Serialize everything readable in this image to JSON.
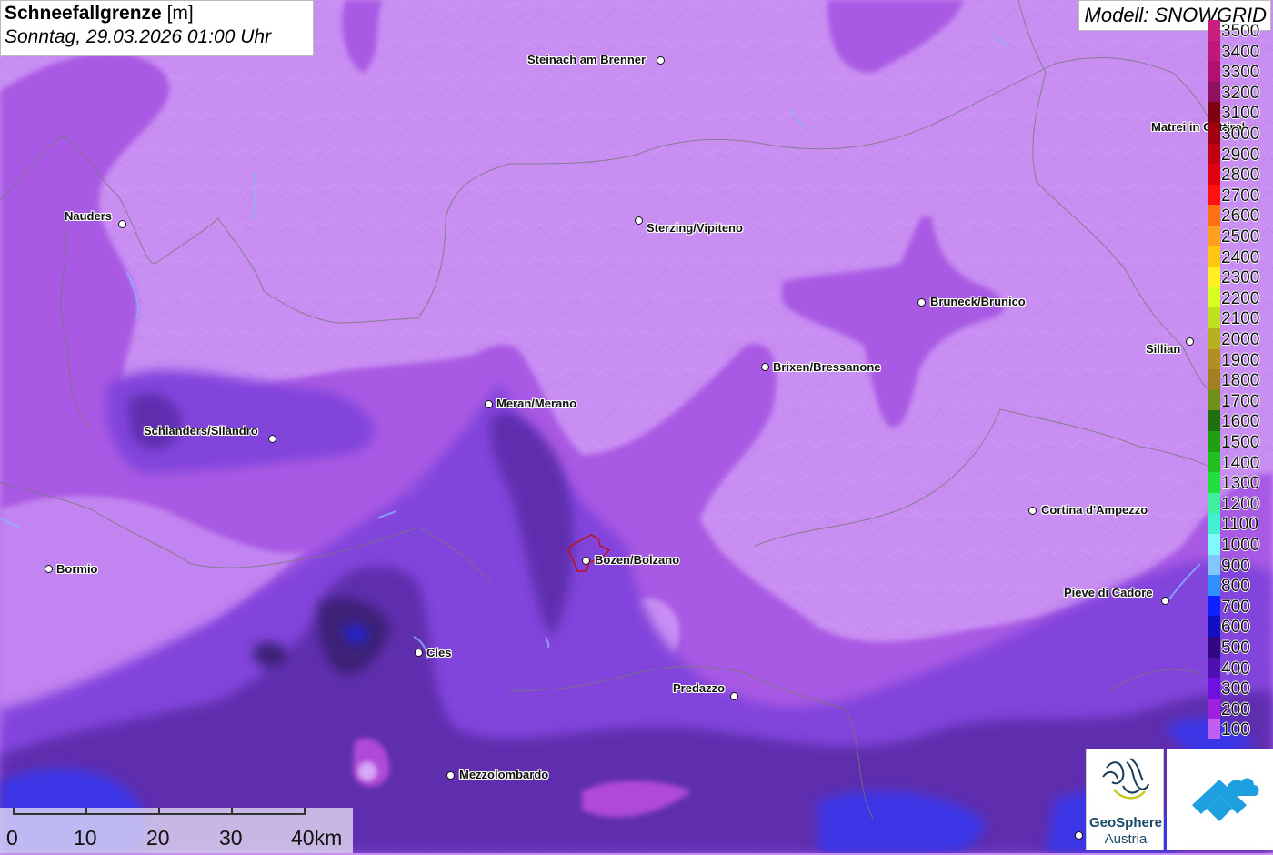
{
  "title": {
    "parameter": "Schneefallgrenze",
    "unit": "[m]",
    "datetime": "Sonntag, 29.03.2026 01:00 Uhr"
  },
  "model": "Modell: SNOWGRID",
  "cities": [
    {
      "name": "Steinach am Brenner"
    },
    {
      "name": "Matrei in Osttirol"
    },
    {
      "name": "Nauders"
    },
    {
      "name": "Sterzing/Vipiteno"
    },
    {
      "name": "Bruneck/Brunico"
    },
    {
      "name": "Sillian"
    },
    {
      "name": "Brixen/Bressanone"
    },
    {
      "name": "Meran/Merano"
    },
    {
      "name": "Schlanders/Silandro"
    },
    {
      "name": "Cortina d'Ampezzo"
    },
    {
      "name": "Bormio"
    },
    {
      "name": "Bozen/Bolzano"
    },
    {
      "name": "Pieve di Cadore"
    },
    {
      "name": "Cles"
    },
    {
      "name": "Predazzo"
    },
    {
      "name": "Mezzolombardo"
    }
  ],
  "legend": [
    {
      "label": "3500",
      "color": "#c8207e"
    },
    {
      "label": "3400",
      "color": "#c01878"
    },
    {
      "label": "3300",
      "color": "#b01070"
    },
    {
      "label": "3200",
      "color": "#901060"
    },
    {
      "label": "3100",
      "color": "#800010"
    },
    {
      "label": "3000",
      "color": "#a00010"
    },
    {
      "label": "2900",
      "color": "#c00010"
    },
    {
      "label": "2800",
      "color": "#e00010"
    },
    {
      "label": "2700",
      "color": "#ff1010"
    },
    {
      "label": "2600",
      "color": "#ff7010"
    },
    {
      "label": "2500",
      "color": "#ffa020"
    },
    {
      "label": "2400",
      "color": "#ffc810"
    },
    {
      "label": "2300",
      "color": "#fff020"
    },
    {
      "label": "2200",
      "color": "#d8ff20"
    },
    {
      "label": "2100",
      "color": "#c0e020"
    },
    {
      "label": "2000",
      "color": "#b8b020"
    },
    {
      "label": "1900",
      "color": "#b09020"
    },
    {
      "label": "1800",
      "color": "#a08020"
    },
    {
      "label": "1700",
      "color": "#70901a"
    },
    {
      "label": "1600",
      "color": "#207010"
    },
    {
      "label": "1500",
      "color": "#20a010"
    },
    {
      "label": "1400",
      "color": "#20c020"
    },
    {
      "label": "1300",
      "color": "#20e040"
    },
    {
      "label": "1200",
      "color": "#40f0a0"
    },
    {
      "label": "1100",
      "color": "#40f0d0"
    },
    {
      "label": "1000",
      "color": "#80f8ff"
    },
    {
      "label": "900",
      "color": "#80c8ff"
    },
    {
      "label": "800",
      "color": "#3090ff"
    },
    {
      "label": "700",
      "color": "#1020ff"
    },
    {
      "label": "600",
      "color": "#1010c0"
    },
    {
      "label": "500",
      "color": "#300880"
    },
    {
      "label": "400",
      "color": "#5010b0"
    },
    {
      "label": "300",
      "color": "#7010e0"
    },
    {
      "label": "200",
      "color": "#a020e0"
    },
    {
      "label": "100",
      "color": "#c060f0"
    }
  ],
  "scale": {
    "labels": [
      "0",
      "10",
      "20",
      "30",
      "40km"
    ]
  },
  "logos": {
    "geosphere_name": "GeoSphere",
    "geosphere_sub": "Austria"
  },
  "colors": {
    "base": "#c78cf0",
    "mid": "#a55ae0",
    "deep": "#7a3fd8",
    "dark": "#5a2aa8",
    "blue": "#3a30e0"
  }
}
